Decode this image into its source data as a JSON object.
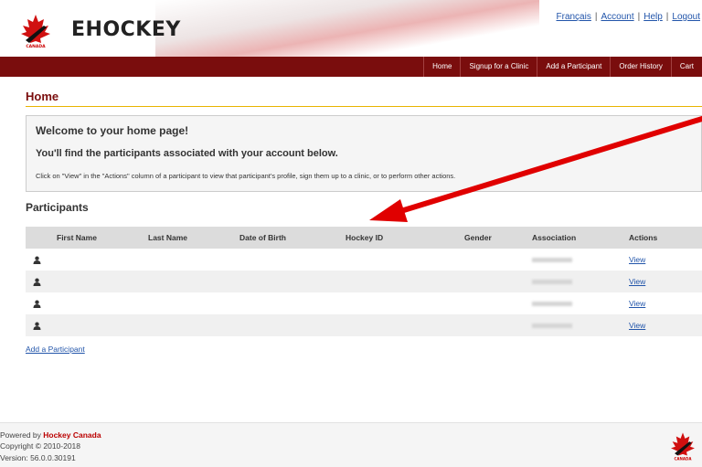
{
  "header": {
    "logo_text": "EHOCKEY",
    "links": [
      "Français",
      "Account",
      "Help",
      "Logout"
    ]
  },
  "nav": {
    "items": [
      "Home",
      "Signup for a Clinic",
      "Add a Participant",
      "Order History",
      "Cart"
    ]
  },
  "page": {
    "title": "Home",
    "welcome_heading": "Welcome to your home page!",
    "welcome_subheading": "You'll find the participants associated with your account below.",
    "welcome_text": "Click on \"View\" in the \"Actions\" column of a participant to view that participant's profile, sign them up to a clinic, or to perform other actions.",
    "participants_title": "Participants"
  },
  "table": {
    "columns": [
      "First Name",
      "Last Name",
      "Date of Birth",
      "Hockey ID",
      "Gender",
      "Association",
      "Actions"
    ],
    "rows": [
      {
        "action": "View"
      },
      {
        "action": "View"
      },
      {
        "action": "View"
      },
      {
        "action": "View"
      }
    ]
  },
  "add_participant_link": "Add a Participant",
  "footer": {
    "powered_by_prefix": "Powered by ",
    "powered_by_brand": "Hockey Canada",
    "copyright": "Copyright © 2010-2018",
    "version": "Version: 56.0.0.30191"
  },
  "colors": {
    "nav_bar": "#7a0d0d",
    "title": "#7a0d0d",
    "title_rule": "#e8b400",
    "link": "#2255aa",
    "annotation_arrow": "#e00000"
  }
}
